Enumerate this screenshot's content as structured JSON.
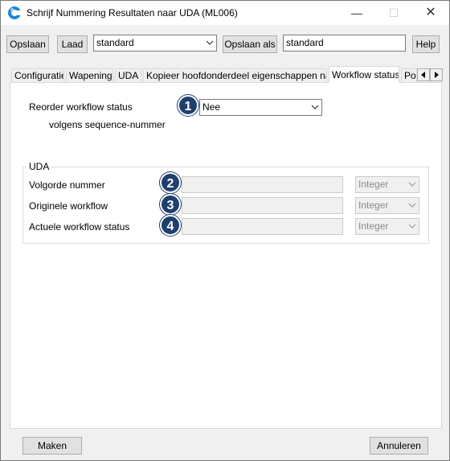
{
  "window": {
    "title": "Schrijf Nummering Resultaten naar UDA (ML006)"
  },
  "toolbar": {
    "save_label": "Opslaan",
    "load_label": "Laad",
    "preset_value": "standard",
    "save_as_label": "Opslaan als",
    "save_as_value": "standard",
    "help_label": "Help"
  },
  "tabs": [
    {
      "label": "Configuratie"
    },
    {
      "label": "Wapening"
    },
    {
      "label": "UDA"
    },
    {
      "label": "Kopieer hoofdonderdeel eigenschappen naar"
    },
    {
      "label": "Workflow status"
    },
    {
      "label": "Pos"
    }
  ],
  "content": {
    "reorder_label": "Reorder workflow status",
    "reorder_sub_label": "volgens sequence-nummer",
    "reorder_value": "Nee",
    "uda_group_label": "UDA",
    "fields": [
      {
        "label": "Volgorde nummer",
        "value": "",
        "type": "Integer",
        "badge": "2"
      },
      {
        "label": "Originele workflow",
        "value": "",
        "type": "Integer",
        "badge": "3"
      },
      {
        "label": "Actuele workflow status",
        "value": "",
        "type": "Integer",
        "badge": "4"
      }
    ],
    "badge_1": "1"
  },
  "footer": {
    "make_label": "Maken",
    "cancel_label": "Annuleren"
  },
  "colors": {
    "badge": "#1f3f6e",
    "window_bg": "#f0f0f0"
  }
}
